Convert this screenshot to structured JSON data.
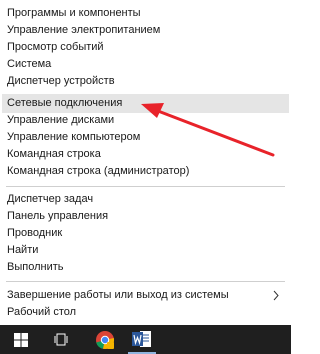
{
  "menu": {
    "items": [
      {
        "label": "Программы и компоненты"
      },
      {
        "label": "Управление электропитанием"
      },
      {
        "label": "Просмотр событий"
      },
      {
        "label": "Система"
      },
      {
        "label": "Диспетчер устройств"
      },
      {
        "label": "Сетевые подключения",
        "highlighted": true
      },
      {
        "label": "Управление дисками"
      },
      {
        "label": "Управление компьютером"
      },
      {
        "label": "Командная строка"
      },
      {
        "label": "Командная строка (администратор)"
      },
      {
        "label": "Диспетчер задач"
      },
      {
        "label": "Панель управления"
      },
      {
        "label": "Проводник"
      },
      {
        "label": "Найти"
      },
      {
        "label": "Выполнить"
      },
      {
        "label": "Завершение работы или выход из системы",
        "submenu": true
      },
      {
        "label": "Рабочий стол"
      }
    ],
    "highlight_color": "#e5e5e5"
  },
  "annotation": {
    "arrow_color": "#e8232a"
  },
  "taskbar": {
    "background": "#1f1f1f",
    "buttons": [
      {
        "icon": "windows-logo-icon"
      },
      {
        "icon": "task-view-icon"
      },
      {
        "icon": "chrome-icon"
      },
      {
        "icon": "word-icon"
      }
    ]
  }
}
